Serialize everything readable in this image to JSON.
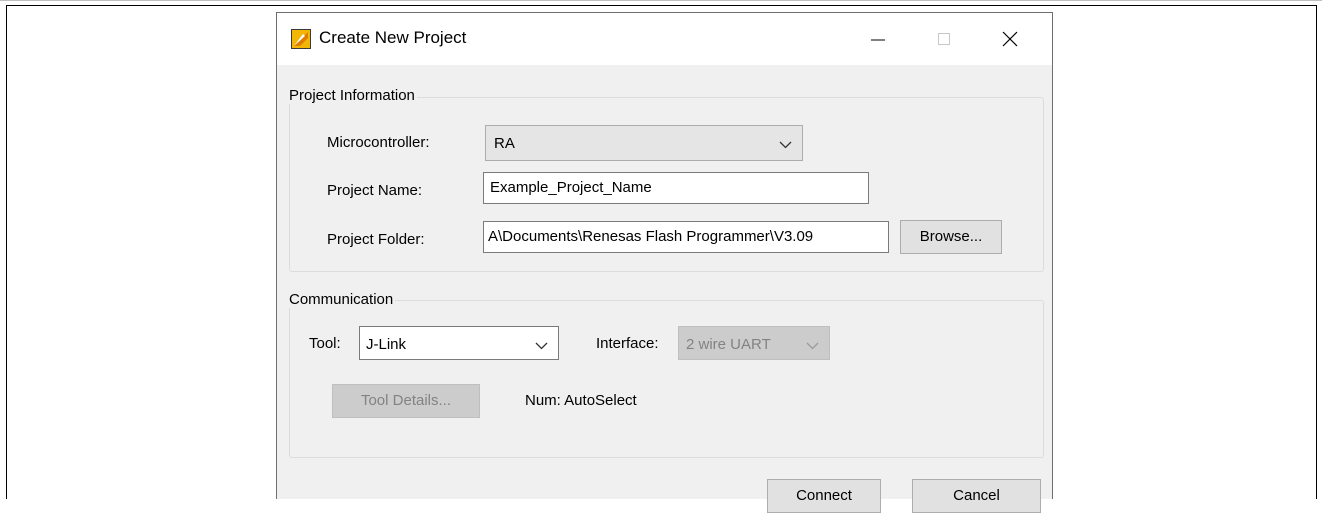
{
  "window": {
    "title": "Create New Project",
    "controls": {
      "minimize": "minimize-icon",
      "maximize": "maximize-icon",
      "close": "close-icon"
    }
  },
  "project_info": {
    "legend": "Project Information",
    "microcontroller_label": "Microcontroller:",
    "microcontroller_value": "RA",
    "project_name_label": "Project Name:",
    "project_name_value": "Example_Project_Name",
    "project_folder_label": "Project Folder:",
    "project_folder_value": "A\\Documents\\Renesas Flash Programmer\\V3.09",
    "browse_label": "Browse..."
  },
  "communication": {
    "legend": "Communication",
    "tool_label": "Tool:",
    "tool_value": "J-Link",
    "interface_label": "Interface:",
    "interface_value": "2 wire UART",
    "tool_details_label": "Tool Details...",
    "num_text": "Num: AutoSelect"
  },
  "footer": {
    "connect_label": "Connect",
    "cancel_label": "Cancel"
  }
}
